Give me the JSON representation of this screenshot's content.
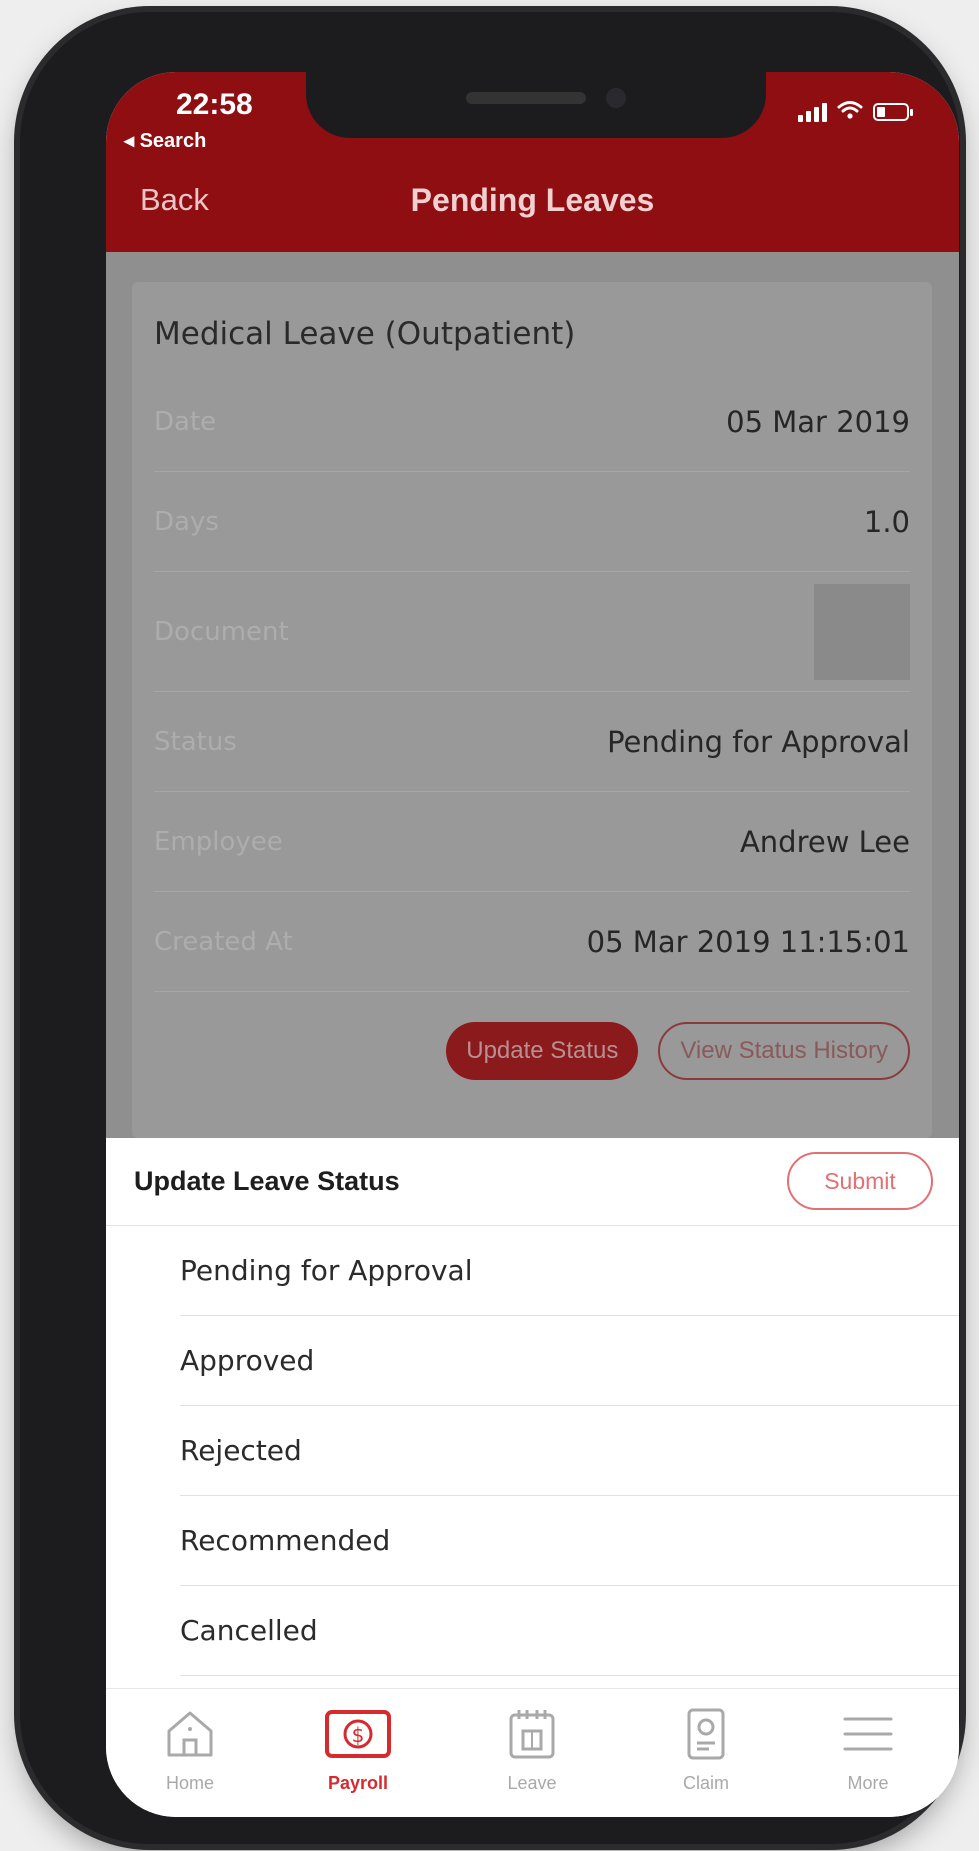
{
  "status_bar": {
    "time": "22:58",
    "back_app": "◂ Search"
  },
  "nav": {
    "back_label": "Back",
    "title": "Pending Leaves"
  },
  "leave_card": {
    "title": "Medical Leave (Outpatient)",
    "rows": [
      {
        "label": "Date",
        "value": "05 Mar 2019"
      },
      {
        "label": "Days",
        "value": "1.0"
      },
      {
        "label": "Document",
        "value": ""
      },
      {
        "label": "Status",
        "value": "Pending for Approval"
      },
      {
        "label": "Employee",
        "value": "Andrew Lee"
      },
      {
        "label": "Created At",
        "value": "05 Mar 2019 11:15:01"
      }
    ],
    "update_status_label": "Update Status",
    "view_history_label": "View Status History"
  },
  "sheet": {
    "title": "Update Leave Status",
    "submit_label": "Submit",
    "options": [
      "Pending for Approval",
      "Approved",
      "Rejected",
      "Recommended",
      "Cancelled"
    ]
  },
  "tabbar": {
    "items": [
      {
        "label": "Home",
        "icon": "home-icon"
      },
      {
        "label": "Payroll",
        "icon": "payroll-icon",
        "active": true
      },
      {
        "label": "Leave",
        "icon": "leave-calendar-icon"
      },
      {
        "label": "Claim",
        "icon": "claim-icon"
      },
      {
        "label": "More",
        "icon": "menu-icon"
      }
    ]
  },
  "colors": {
    "header": "#8e0e12",
    "accent": "#d62a2f",
    "dim_overlay": "#8f8f8f"
  }
}
